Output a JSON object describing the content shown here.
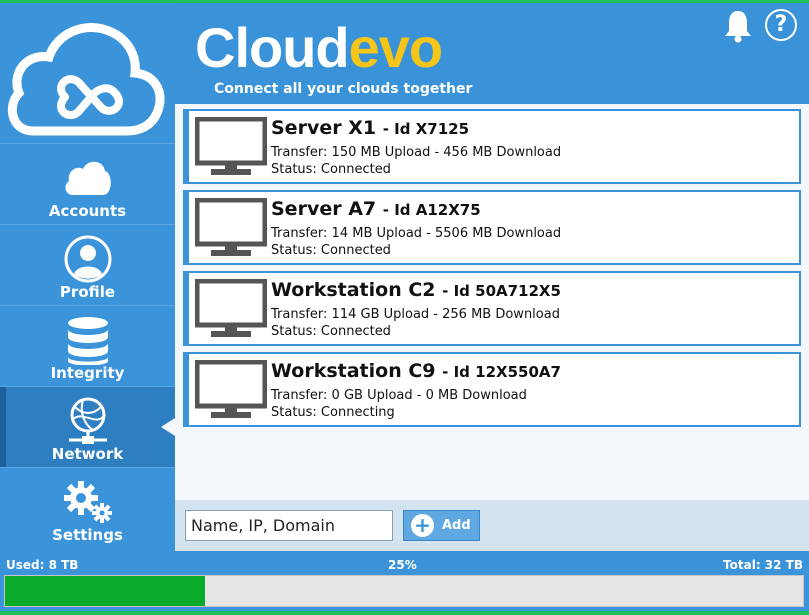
{
  "app": {
    "brand_part1": "Cloud",
    "brand_part2": "evo",
    "tagline": "Connect all your clouds together"
  },
  "sidebar": {
    "items": [
      {
        "label": "Accounts",
        "icon": "cloud-icon",
        "active": false
      },
      {
        "label": "Profile",
        "icon": "user-icon",
        "active": false
      },
      {
        "label": "Integrity",
        "icon": "database-icon",
        "active": false
      },
      {
        "label": "Network",
        "icon": "network-globe-icon",
        "active": true
      },
      {
        "label": "Settings",
        "icon": "gears-icon",
        "active": false
      }
    ]
  },
  "header": {
    "help_label": "?",
    "bell_icon": "bell-icon"
  },
  "servers": [
    {
      "name": "Server X1",
      "id": "- Id X7125",
      "transfer": "Transfer: 150 MB Upload - 456 MB Download",
      "status": "Status: Connected"
    },
    {
      "name": "Server A7",
      "id": "- Id A12X75",
      "transfer": "Transfer: 14 MB Upload - 5506 MB Download",
      "status": "Status: Connected"
    },
    {
      "name": "Workstation C2",
      "id": "- Id 50A712X5",
      "transfer": "Transfer: 114 GB Upload - 256 MB Download",
      "status": "Status: Connected"
    },
    {
      "name": "Workstation C9",
      "id": "- Id 12X550A7",
      "transfer": "Transfer: 0 GB Upload - 0 MB Download",
      "status": "Status: Connecting"
    }
  ],
  "add": {
    "placeholder": "Name, IP, Domain",
    "button_label": "Add"
  },
  "storage": {
    "used": "Used: 8 TB",
    "percent_label": "25%",
    "total": "Total: 32 TB",
    "fraction": 0.25
  },
  "colors": {
    "accent": "#3b94da",
    "brand_yellow": "#f5c518",
    "progress_green": "#0aaa2a",
    "dark_icon": "#555555"
  }
}
